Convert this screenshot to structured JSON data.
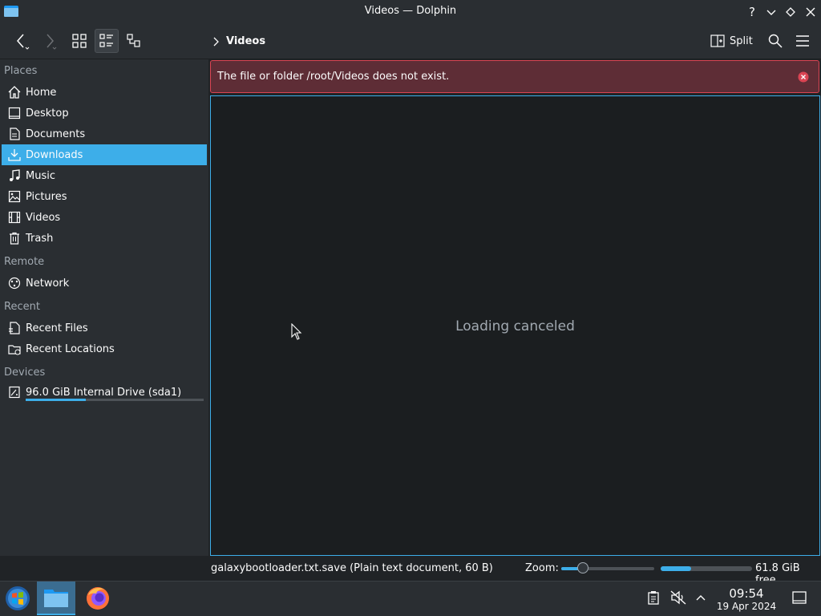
{
  "window": {
    "title": "Videos — Dolphin"
  },
  "toolbar": {
    "breadcrumb": "Videos",
    "split_label": "Split"
  },
  "sidebar": {
    "sections": {
      "places": "Places",
      "remote": "Remote",
      "recent": "Recent",
      "devices": "Devices"
    },
    "places": [
      {
        "label": "Home",
        "icon": "home-icon"
      },
      {
        "label": "Desktop",
        "icon": "desktop-icon"
      },
      {
        "label": "Documents",
        "icon": "documents-icon"
      },
      {
        "label": "Downloads",
        "icon": "download-icon",
        "selected": true
      },
      {
        "label": "Music",
        "icon": "music-icon"
      },
      {
        "label": "Pictures",
        "icon": "pictures-icon"
      },
      {
        "label": "Videos",
        "icon": "videos-icon"
      },
      {
        "label": "Trash",
        "icon": "trash-icon"
      }
    ],
    "remote": [
      {
        "label": "Network",
        "icon": "network-icon"
      }
    ],
    "recent": [
      {
        "label": "Recent Files",
        "icon": "recent-files-icon"
      },
      {
        "label": "Recent Locations",
        "icon": "recent-locations-icon"
      }
    ],
    "devices": [
      {
        "label": "96.0 GiB Internal Drive (sda1)",
        "icon": "drive-icon",
        "usage": 0.34
      }
    ]
  },
  "main": {
    "error_message": "The file or folder /root/Videos does not exist.",
    "placeholder": "Loading canceled"
  },
  "statusbar": {
    "file_info": "galaxybootloader.txt.save (Plain text document, 60 B)",
    "zoom_label": "Zoom:",
    "zoom_level": 0.23,
    "space_used_fraction": 0.33,
    "free_space": "61.8 GiB free"
  },
  "taskbar": {
    "time": "09:54",
    "date": "19 Apr 2024"
  },
  "colors": {
    "accent": "#3daee9",
    "error": "#da4453",
    "window_bg": "#2a2e32",
    "view_bg": "#1b1e20"
  }
}
